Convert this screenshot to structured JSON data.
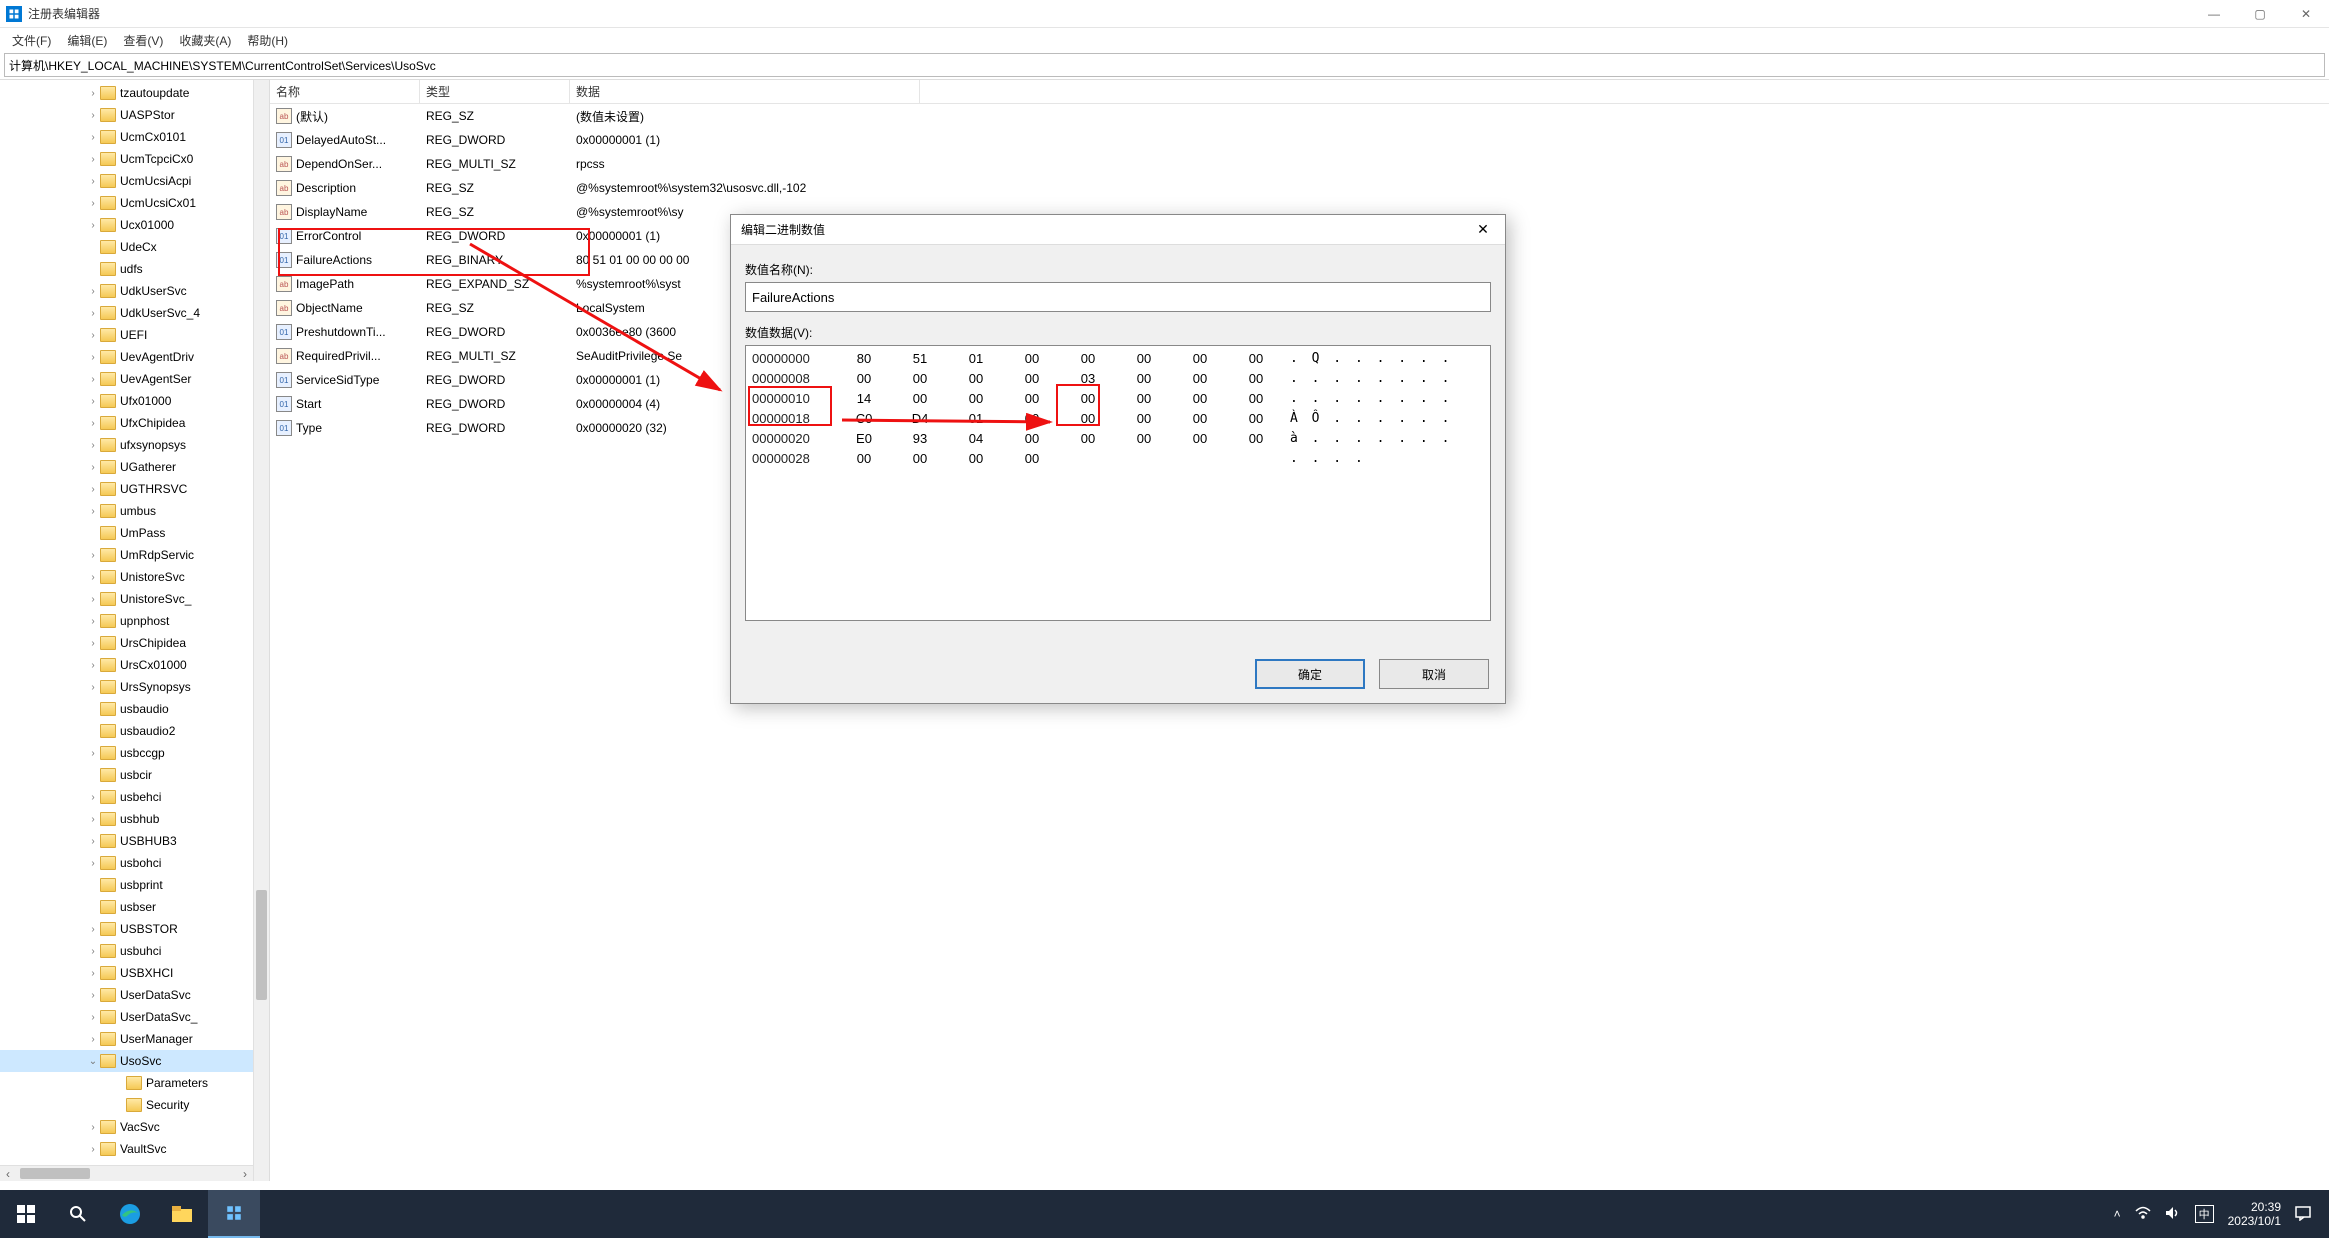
{
  "window": {
    "title": "注册表编辑器",
    "menus": [
      "文件(F)",
      "编辑(E)",
      "查看(V)",
      "收藏夹(A)",
      "帮助(H)"
    ],
    "address": "计算机\\HKEY_LOCAL_MACHINE\\SYSTEM\\CurrentControlSet\\Services\\UsoSvc"
  },
  "tree": {
    "items": [
      {
        "label": "tzautoupdate",
        "chev": "›"
      },
      {
        "label": "UASPStor",
        "chev": "›"
      },
      {
        "label": "UcmCx0101",
        "chev": "›"
      },
      {
        "label": "UcmTcpciCx0",
        "chev": "›"
      },
      {
        "label": "UcmUcsiAcpi",
        "chev": "›"
      },
      {
        "label": "UcmUcsiCx01",
        "chev": "›"
      },
      {
        "label": "Ucx01000",
        "chev": "›"
      },
      {
        "label": "UdeCx",
        "chev": ""
      },
      {
        "label": "udfs",
        "chev": ""
      },
      {
        "label": "UdkUserSvc",
        "chev": "›"
      },
      {
        "label": "UdkUserSvc_4",
        "chev": "›"
      },
      {
        "label": "UEFI",
        "chev": "›"
      },
      {
        "label": "UevAgentDriv",
        "chev": "›"
      },
      {
        "label": "UevAgentSer",
        "chev": "›"
      },
      {
        "label": "Ufx01000",
        "chev": "›"
      },
      {
        "label": "UfxChipidea",
        "chev": "›"
      },
      {
        "label": "ufxsynopsys",
        "chev": "›"
      },
      {
        "label": "UGatherer",
        "chev": "›"
      },
      {
        "label": "UGTHRSVC",
        "chev": "›"
      },
      {
        "label": "umbus",
        "chev": "›"
      },
      {
        "label": "UmPass",
        "chev": ""
      },
      {
        "label": "UmRdpServic",
        "chev": "›"
      },
      {
        "label": "UnistoreSvc",
        "chev": "›"
      },
      {
        "label": "UnistoreSvc_",
        "chev": "›"
      },
      {
        "label": "upnphost",
        "chev": "›"
      },
      {
        "label": "UrsChipidea",
        "chev": "›"
      },
      {
        "label": "UrsCx01000",
        "chev": "›"
      },
      {
        "label": "UrsSynopsys",
        "chev": "›"
      },
      {
        "label": "usbaudio",
        "chev": ""
      },
      {
        "label": "usbaudio2",
        "chev": ""
      },
      {
        "label": "usbccgp",
        "chev": "›"
      },
      {
        "label": "usbcir",
        "chev": ""
      },
      {
        "label": "usbehci",
        "chev": "›"
      },
      {
        "label": "usbhub",
        "chev": "›"
      },
      {
        "label": "USBHUB3",
        "chev": "›"
      },
      {
        "label": "usbohci",
        "chev": "›"
      },
      {
        "label": "usbprint",
        "chev": ""
      },
      {
        "label": "usbser",
        "chev": ""
      },
      {
        "label": "USBSTOR",
        "chev": "›"
      },
      {
        "label": "usbuhci",
        "chev": "›"
      },
      {
        "label": "USBXHCI",
        "chev": "›"
      },
      {
        "label": "UserDataSvc",
        "chev": "›"
      },
      {
        "label": "UserDataSvc_",
        "chev": "›"
      },
      {
        "label": "UserManager",
        "chev": "›"
      },
      {
        "label": "UsoSvc",
        "chev": "⌄",
        "sel": true
      },
      {
        "label": "Parameters",
        "chev": "",
        "child": true
      },
      {
        "label": "Security",
        "chev": "",
        "child": true
      },
      {
        "label": "VacSvc",
        "chev": "›"
      },
      {
        "label": "VaultSvc",
        "chev": "›"
      }
    ]
  },
  "list": {
    "headers": {
      "name": "名称",
      "type": "类型",
      "data": "数据"
    },
    "rows": [
      {
        "icon": "str",
        "name": "(默认)",
        "type": "REG_SZ",
        "data": "(数值未设置)"
      },
      {
        "icon": "bin",
        "name": "DelayedAutoSt...",
        "type": "REG_DWORD",
        "data": "0x00000001 (1)"
      },
      {
        "icon": "str",
        "name": "DependOnSer...",
        "type": "REG_MULTI_SZ",
        "data": "rpcss"
      },
      {
        "icon": "str",
        "name": "Description",
        "type": "REG_SZ",
        "data": "@%systemroot%\\system32\\usosvc.dll,-102"
      },
      {
        "icon": "str",
        "name": "DisplayName",
        "type": "REG_SZ",
        "data": "@%systemroot%\\sy"
      },
      {
        "icon": "bin",
        "name": "ErrorControl",
        "type": "REG_DWORD",
        "data": "0x00000001 (1)",
        "hl": true
      },
      {
        "icon": "bin",
        "name": "FailureActions",
        "type": "REG_BINARY",
        "data": "80 51 01 00 00 00 00",
        "hl": true
      },
      {
        "icon": "str",
        "name": "ImagePath",
        "type": "REG_EXPAND_SZ",
        "data": "%systemroot%\\syst"
      },
      {
        "icon": "str",
        "name": "ObjectName",
        "type": "REG_SZ",
        "data": "LocalSystem"
      },
      {
        "icon": "bin",
        "name": "PreshutdownTi...",
        "type": "REG_DWORD",
        "data": "0x0036ee80 (3600"
      },
      {
        "icon": "str",
        "name": "RequiredPrivil...",
        "type": "REG_MULTI_SZ",
        "data": "SeAuditPrivilege Se"
      },
      {
        "icon": "bin",
        "name": "ServiceSidType",
        "type": "REG_DWORD",
        "data": "0x00000001 (1)"
      },
      {
        "icon": "bin",
        "name": "Start",
        "type": "REG_DWORD",
        "data": "0x00000004 (4)"
      },
      {
        "icon": "bin",
        "name": "Type",
        "type": "REG_DWORD",
        "data": "0x00000020 (32)"
      }
    ]
  },
  "dialog": {
    "title": "编辑二进制数值",
    "name_label": "数值名称(N):",
    "name_value": "FailureActions",
    "data_label": "数值数据(V):",
    "ok": "确定",
    "cancel": "取消",
    "hex": [
      {
        "addr": "00000000",
        "b": [
          "80",
          "51",
          "01",
          "00",
          "00",
          "00",
          "00",
          "00"
        ],
        "asc": ". Q . . . . . ."
      },
      {
        "addr": "00000008",
        "b": [
          "00",
          "00",
          "00",
          "00",
          "03",
          "00",
          "00",
          "00"
        ],
        "asc": ". . . . . . . ."
      },
      {
        "addr": "00000010",
        "b": [
          "14",
          "00",
          "00",
          "00",
          "00",
          "00",
          "00",
          "00"
        ],
        "asc": ". . . . . . . ."
      },
      {
        "addr": "00000018",
        "b": [
          "C0",
          "D4",
          "01",
          "00",
          "00",
          "00",
          "00",
          "00"
        ],
        "asc": "À Ô . . . . . ."
      },
      {
        "addr": "00000020",
        "b": [
          "E0",
          "93",
          "04",
          "00",
          "00",
          "00",
          "00",
          "00"
        ],
        "asc": "à . . . . . . ."
      },
      {
        "addr": "00000028",
        "b": [
          "00",
          "00",
          "00",
          "00",
          "",
          "",
          "",
          ""
        ],
        "asc": ". . . ."
      }
    ]
  },
  "taskbar": {
    "ime": "中",
    "time": "20:39",
    "date": "2023/10/1"
  }
}
